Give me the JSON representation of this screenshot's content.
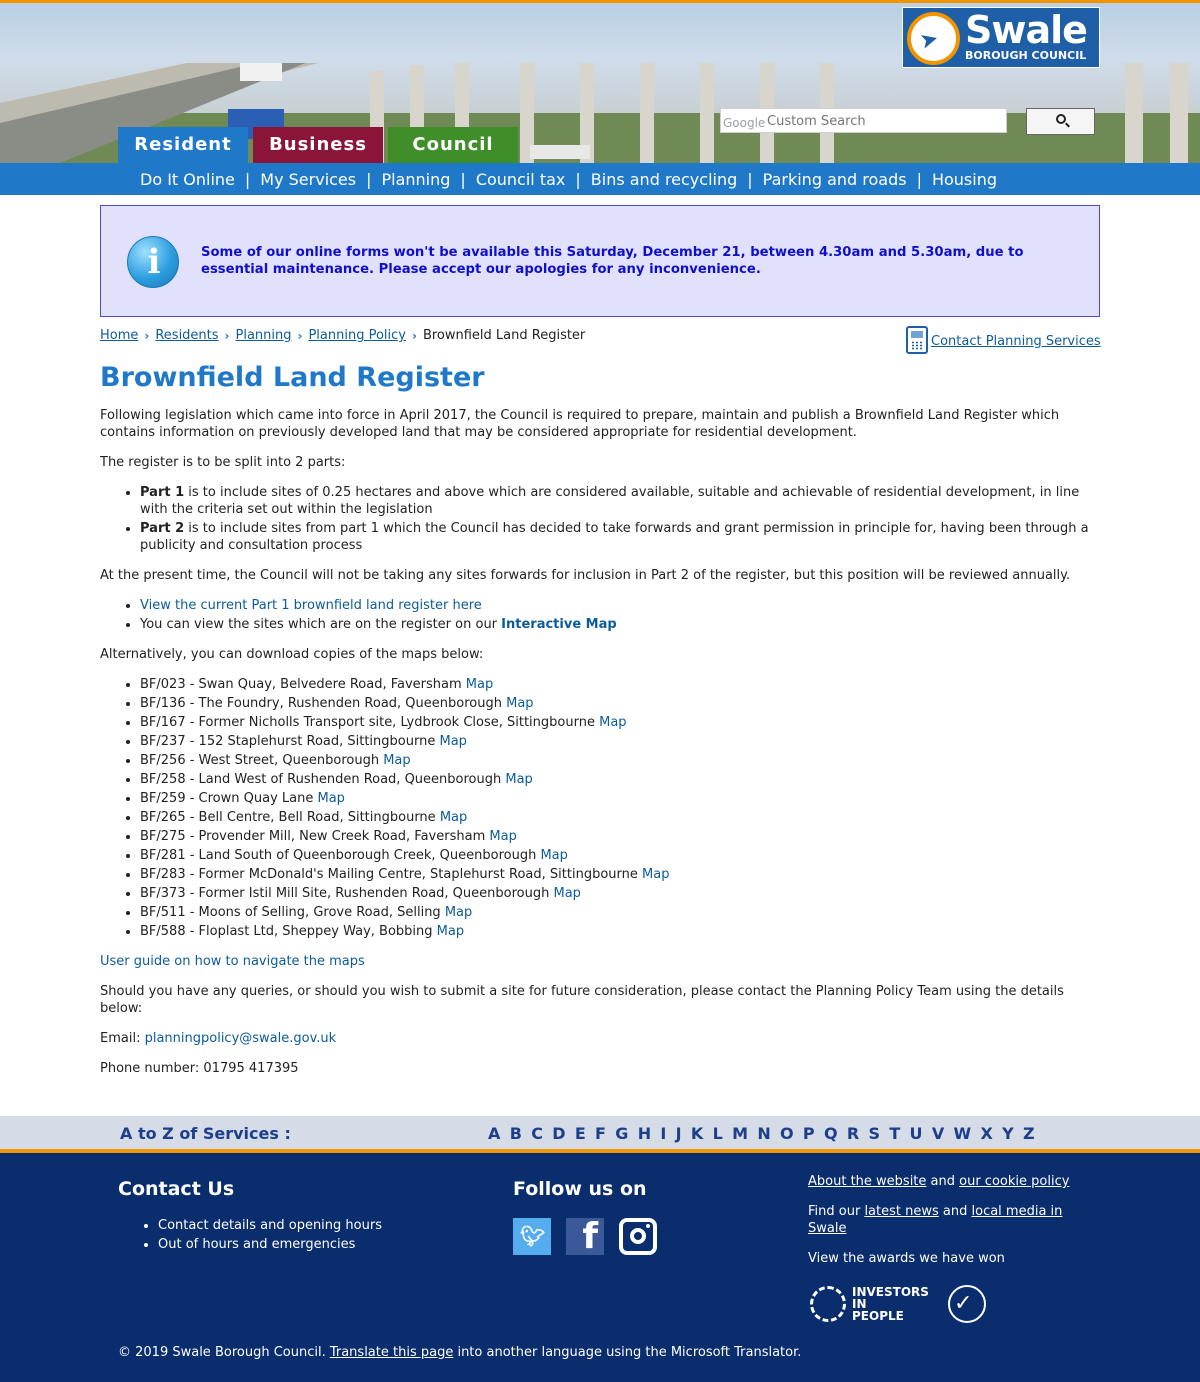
{
  "header": {
    "logo_name": "Swale",
    "logo_sub": "BOROUGH COUNCIL",
    "search_brand": "Google",
    "search_placeholder": "Custom Search",
    "tabs": [
      "Resident",
      "Business",
      "Council"
    ]
  },
  "nav": [
    "Do It Online",
    "My Services",
    "Planning",
    "Council tax",
    "Bins and recycling",
    "Parking and roads",
    "Housing"
  ],
  "alert": {
    "icon": "info-icon",
    "message": "Some of our online forms won't be available this Saturday, December 21, between 4.30am and 5.30am, due to essential maintenance. Please accept our apologies for any inconvenience."
  },
  "breadcrumb": {
    "items": [
      "Home",
      "Residents",
      "Planning",
      "Planning Policy "
    ],
    "current": "Brownfield Land Register"
  },
  "contact_link": "Contact Planning Services",
  "page_title": "Brownfield Land Register",
  "content": {
    "intro": "Following legislation which came into force in April 2017, the Council is required to prepare, maintain and publish a Brownfield Land Register which contains information on previously developed land that may be considered appropriate for residential development.",
    "split": "The register is to be split into 2 parts:",
    "part1_label": "Part 1",
    "part1_text": " is to include sites of 0.25 hectares and above which are considered available, suitable and achievable of residential development, in line with the criteria set out within the legislation",
    "part2_label": "Part 2",
    "part2_text": " is to include sites from part 1 which the Council has decided to take forwards and grant permission in principle for, having been through a publicity and consultation process",
    "present": "At the present time, the Council will not be taking any sites forwards for inclusion in Part 2 of the register, but this position will be reviewed annually.",
    "view_register_link": "View the current Part 1 brownfield land register here",
    "view_sites_text": "You can view the sites which are on the register on our ",
    "interactive_map_link": "Interactive Map",
    "alternatively": "Alternatively, you can download copies of the maps below:",
    "map_link_label": "Map",
    "sites": [
      "BF/023 - Swan Quay, Belvedere Road, Faversham",
      "BF/136 - The Foundry, Rushenden Road, Queenborough",
      "BF/167 - Former Nicholls Transport site, Lydbrook Close, Sittingbourne",
      "BF/237 - 152 Staplehurst Road, Sittingbourne",
      "BF/256 - West Street, Queenborough",
      "BF/258 - Land West of Rushenden Road, Queenborough",
      "BF/259 - Crown Quay Lane",
      "BF/265 - Bell Centre, Bell Road, Sittingbourne",
      "BF/275 - Provender Mill, New Creek Road, Faversham",
      "BF/281 - Land South of Queenborough Creek, Queenborough",
      "BF/283 - Former McDonald's Mailing Centre, Staplehurst Road, Sittingbourne",
      "BF/373 - Former Istil Mill Site, Rushenden Road, Queenborough",
      "BF/511 - Moons of Selling, Grove Road, Selling",
      "BF/588 - Floplast Ltd, Sheppey Way, Bobbing"
    ],
    "user_guide_link": "User guide on how to navigate the maps",
    "queries": "Should you have any queries, or should you wish to submit a site for future consideration, please contact the Planning Policy Team using the details below:",
    "email_label": "Email: ",
    "email": "planningpolicy@swale.gov.uk",
    "phone": "Phone number: 01795 417395"
  },
  "az": {
    "label": "A to Z of Services :",
    "letters": [
      "A",
      "B",
      "C",
      "D",
      "E",
      "F",
      "G",
      "H",
      "I",
      "J",
      "K",
      "L",
      "M",
      "N",
      "O",
      "P",
      "Q",
      "R",
      "S",
      "T",
      "U",
      "V",
      "W",
      "X",
      "Y",
      "Z"
    ]
  },
  "footer": {
    "contact_title": "Contact Us",
    "contact_items": [
      "Contact details and opening hours",
      "Out of hours and emergencies"
    ],
    "follow_title": "Follow us on",
    "social_icons": [
      "twitter-icon",
      "facebook-icon",
      "instagram-icon"
    ],
    "about_link": "About the website",
    "and": " and ",
    "cookie_link": "our cookie policy",
    "find_our": "Find our ",
    "news_link": "latest news",
    "media_link": "local media in Swale",
    "awards_text": "View the awards we have won",
    "award_iip": "INVESTORS IN PEOPLE",
    "copyright": "© 2019 Swale Borough Council. ",
    "translate_link": "Translate this page",
    "translate_rest": " into another language using the Microsoft Translator."
  },
  "colors": {
    "accent": "#f29400",
    "nav_blue": "#1f78c8",
    "resident_tab": "#1f78c8",
    "business_tab": "#8a1538",
    "council_tab": "#3f8e2a",
    "footer_bg": "#0a2d6e"
  }
}
